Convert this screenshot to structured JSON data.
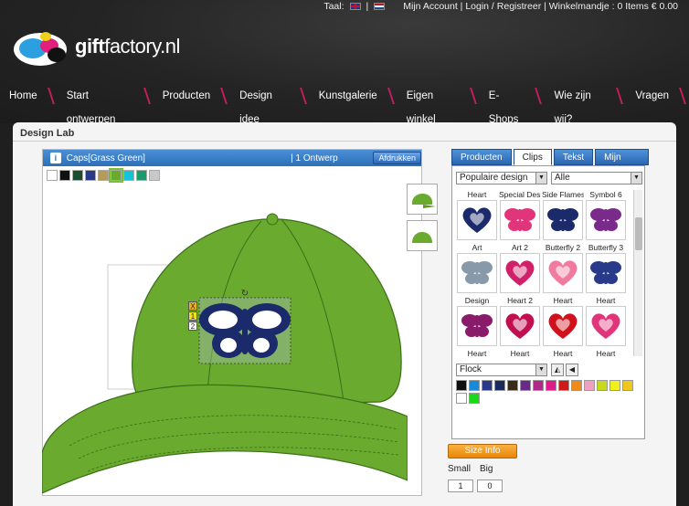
{
  "topbar": {
    "lang_label": "Taal:",
    "separator": "|",
    "account": "Mijn Account | Login / Registreer | Winkelmandje : 0 Items € 0.00"
  },
  "logo": {
    "bold": "gift",
    "rest": "factory.nl"
  },
  "nav": [
    "Home",
    "Start ontwerpen",
    "Producten",
    "Design idee",
    "Kunstgalerie",
    "Eigen winkel",
    "E-Shops",
    "Wie zijn wij?",
    "Vragen"
  ],
  "panel": {
    "title": "Design Lab"
  },
  "canvas": {
    "product": "Caps[Grass Green]",
    "count": "| 1 Ontwerp",
    "print": "Afdrukken",
    "info": "i"
  },
  "product_colors": [
    "#ffffff",
    "#111111",
    "#1a4d2e",
    "#2a3a8a",
    "#b59a5a",
    "#6aaa2a",
    "#16c2d8",
    "#1c9a6a",
    "#c8c8c8"
  ],
  "controls": [
    "X",
    "1",
    "2"
  ],
  "tabs": [
    "Producten",
    "Clips",
    "Tekst",
    "Mijn kunst"
  ],
  "filters": {
    "category": "Populaire design",
    "sub": "Alle"
  },
  "clips": [
    {
      "label": "Heart",
      "color": "#1a2a6a"
    },
    {
      "label": "Special Desi",
      "color": "#e0357a"
    },
    {
      "label": "Side Flames",
      "color": "#1a2a6a"
    },
    {
      "label": "Symbol 6",
      "color": "#7a2a8a"
    },
    {
      "label": "Art",
      "color": "#8899aa"
    },
    {
      "label": "Art 2",
      "color": "#d0206a"
    },
    {
      "label": "Butterfly 2",
      "color": "#f07aa0"
    },
    {
      "label": "Butterfly 3",
      "color": "#2a3a8a"
    },
    {
      "label": "Design",
      "color": "#8a1a6a"
    },
    {
      "label": "Heart 2",
      "color": "#c01050"
    },
    {
      "label": "Heart",
      "color": "#d0101a"
    },
    {
      "label": "Heart",
      "color": "#e0357a"
    },
    {
      "label": "Heart",
      "color": "#d0101a"
    },
    {
      "label": "Heart",
      "color": "#1a2a6a"
    },
    {
      "label": "Heart",
      "color": "#d0101a"
    },
    {
      "label": "Heart",
      "color": "#e0357a"
    }
  ],
  "material": "Flock",
  "ink_colors": [
    "#111111",
    "#1a8ad8",
    "#2a3a8a",
    "#1a2a5a",
    "#3a2a1a",
    "#6a2a8a",
    "#b02a8a",
    "#e01a8a",
    "#d01a1a",
    "#f08a1a",
    "#f0a0c0",
    "#c8d81a",
    "#f0f01a",
    "#f0c81a",
    "#ffffff",
    "#1ad81a"
  ],
  "size": {
    "button": "Size Info",
    "small_label": "Small",
    "big_label": "Big",
    "small": "1",
    "big": "0"
  }
}
